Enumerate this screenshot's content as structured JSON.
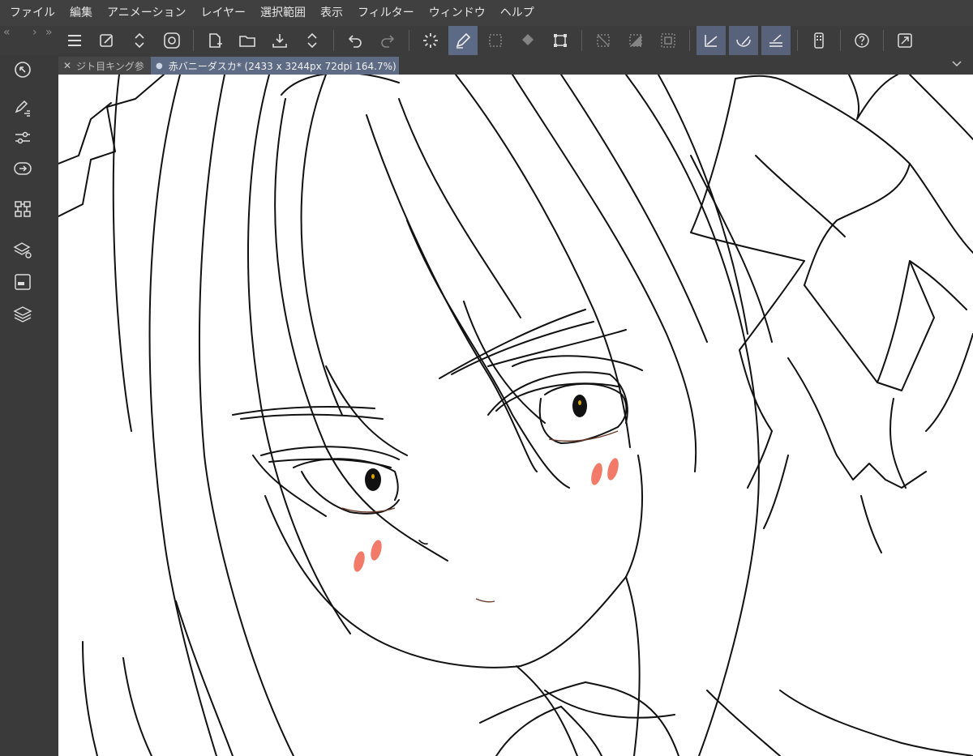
{
  "menu": [
    "ファイル",
    "編集",
    "アニメーション",
    "レイヤー",
    "選択範囲",
    "表示",
    "フィルター",
    "ウィンドウ",
    "ヘルプ"
  ],
  "dock": {
    "collapse_left": "«",
    "collapse_right": "»",
    "arrow": "›"
  },
  "toolbar": {
    "icons": [
      "menu-icon",
      "new-canvas-icon",
      "chevron-updown-icon",
      "clip-studio-icon",
      "new-file-icon",
      "open-folder-icon",
      "save-icon",
      "chevron-updown-icon",
      "undo-icon",
      "redo-icon",
      "loading-icon",
      "pen-icon",
      "selection-icon",
      "fill-icon",
      "transform-icon",
      "deselect-icon",
      "invert-icon",
      "border-icon",
      "line-correct-icon",
      "curve-correct-icon",
      "ruler-icon",
      "device-icon",
      "help-icon",
      "fullscreen-icon"
    ]
  },
  "sidebar": {
    "icons": [
      "zoom-icon",
      "brush-tool-icon",
      "adjust-icon",
      "navigator-icon",
      "material-icon",
      "layer-property-icon",
      "sub-view-icon",
      "layers-icon"
    ]
  },
  "tabs": [
    {
      "label": "ジト目キング参",
      "active": false
    },
    {
      "label": "赤バニーダスカ* (2433 x 3244px 72dpi 164.7%)",
      "active": true
    }
  ],
  "colors": {
    "accent": "#5e6b84",
    "blush": "#f17a68",
    "canvas": "#ffffff",
    "chrome": "#3c3c3c"
  }
}
